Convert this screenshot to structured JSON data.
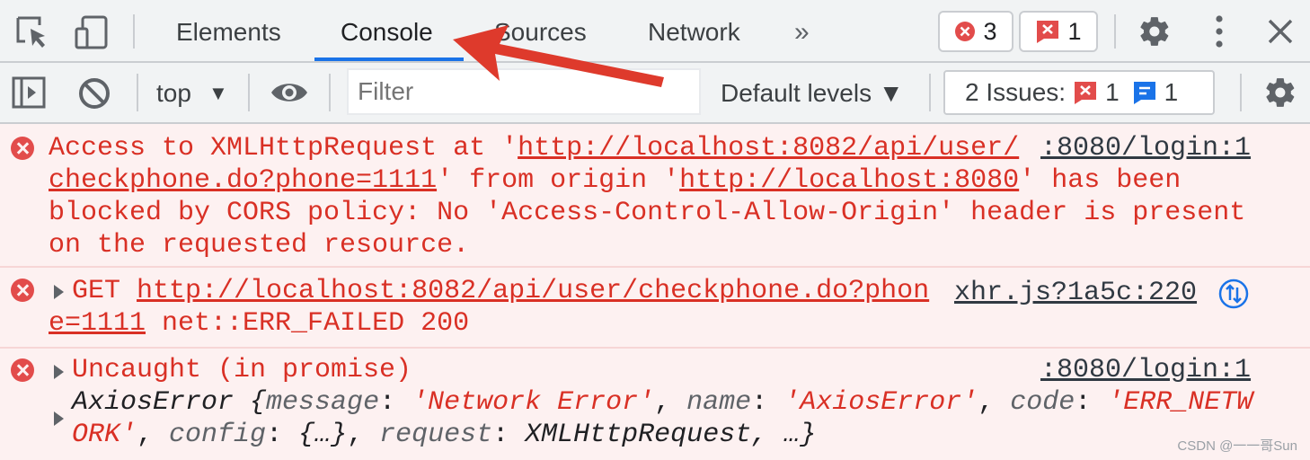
{
  "tabs": [
    "Elements",
    "Console",
    "Sources",
    "Network"
  ],
  "tab_overflow": "»",
  "active_tab": "Console",
  "badges": {
    "errors": "3",
    "issues": "1"
  },
  "toolbar": {
    "context": "top",
    "context_caret": "▼",
    "filter_placeholder": "Filter",
    "levels": "Default levels ▼",
    "issues_label": "2 Issues:",
    "issues_error_count": "1",
    "issues_info_count": "1"
  },
  "messages": {
    "cors": {
      "l1_a": "Access to XMLHttpRequest at '",
      "l1_url": "http://localhost:8082/api/user/",
      "l2_url": "checkphone.do?phone=1111",
      "l2_b": "' from origin '",
      "l2_origin": "http://localhost:8080",
      "l2_c": "' has been",
      "l3": "blocked by CORS policy: No 'Access-Control-Allow-Origin' header is present",
      "l4": "on the requested resource.",
      "source": ":8080/login:1"
    },
    "get": {
      "method": "GET ",
      "url_1": "http://localhost:8082/api/user/checkphone.do?phon",
      "url_2": "e=1111",
      "status": " net::ERR_FAILED 200",
      "source": "xhr.js?1a5c:220"
    },
    "uncaught": {
      "title": "Uncaught (in promise)",
      "source": ":8080/login:1",
      "obj_name": "AxiosError",
      "brace_open": " {",
      "k_message": "message",
      "v_message": "'Network Error'",
      "k_name": "name",
      "v_name": "'AxiosError'",
      "k_code": "code",
      "v_code_1": "'ERR_NETW",
      "v_code_2": "ORK'",
      "k_config": "config",
      "v_config": "{…}",
      "k_request": "request",
      "v_request": "XMLHttpRequest",
      "tail": ", …}"
    }
  },
  "watermark": "CSDN @一一哥Sun",
  "colors": {
    "accent": "#1a73e8",
    "error": "#d93025",
    "arrow": "#de3a2c"
  }
}
